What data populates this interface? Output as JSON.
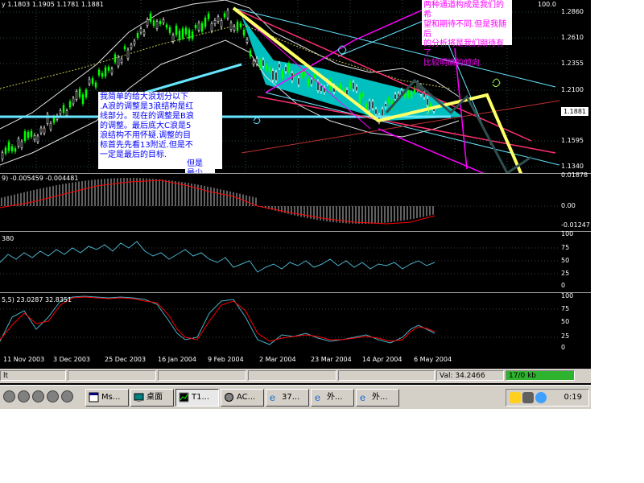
{
  "main_chart": {
    "header_prefix": "y",
    "ohlc": "1.1803 1.1905 1.1781 1.1881",
    "price_ticks": [
      "1.2860",
      "1.2610",
      "1.2355",
      "1.2100",
      "1.1595",
      "1.1340"
    ],
    "last_price": "1.1881",
    "top_right_value": "100.0"
  },
  "annotations": {
    "wave_note_lines": [
      "我简单的给大浪划分以下",
      ".A浪的调整是3浪结构是红",
      "线部分。现在的调整是B浪",
      "的调整。最后底大C浪是5",
      "浪结构不用怀疑.调整的目",
      "标首先先看13附近.但是不",
      "一定是最后的目标."
    ],
    "target_note_lines": [
      "但是",
      "最少",
      "的目",
      "标."
    ],
    "channel_note_lines": [
      "两种通道构成是我们的希",
      "望和期待不同.但是我随后",
      "的分析将是我们期待有了",
      "比较明确的倾向."
    ]
  },
  "macd": {
    "label_prefix": "9)",
    "value1": "-0.005459",
    "value2": "-0.004481",
    "ticks": [
      "0.01878",
      "0.00",
      "-0.01247"
    ]
  },
  "rsi": {
    "label": "380",
    "ticks": [
      "100",
      "75",
      "50",
      "25",
      "0"
    ]
  },
  "stoch": {
    "label": "5,5)",
    "value1": "23.0287",
    "value2": "32.8351",
    "ticks": [
      "100",
      "75",
      "50",
      "25",
      "0"
    ]
  },
  "date_axis": [
    "11 Nov 2003",
    "3 Dec 2003",
    "25 Dec 2003",
    "16 Jan 2004",
    "9 Feb 2004",
    "2 Mar 2004",
    "23 Mar 2004",
    "14 Apr 2004",
    "6 May 2004"
  ],
  "status_bar": {
    "left_text": "lt",
    "value_text": "Val: 34.2466",
    "traffic": "17/0 kb"
  },
  "taskbar": {
    "buttons": [
      "Ms...",
      "桌面",
      "T1...",
      "AC...",
      "37...",
      "外...",
      "外..."
    ],
    "clock": "0:19"
  },
  "colors": {
    "bull_candle": "#00ff00",
    "macd_line": "#ff0000",
    "rsi_line": "#4ab0c8",
    "channel_cyan": "#66e6ff",
    "wave_yellow": "#ffff66",
    "channel_magenta": "#ff00ff",
    "traffic_bg": "#2fb32f"
  }
}
